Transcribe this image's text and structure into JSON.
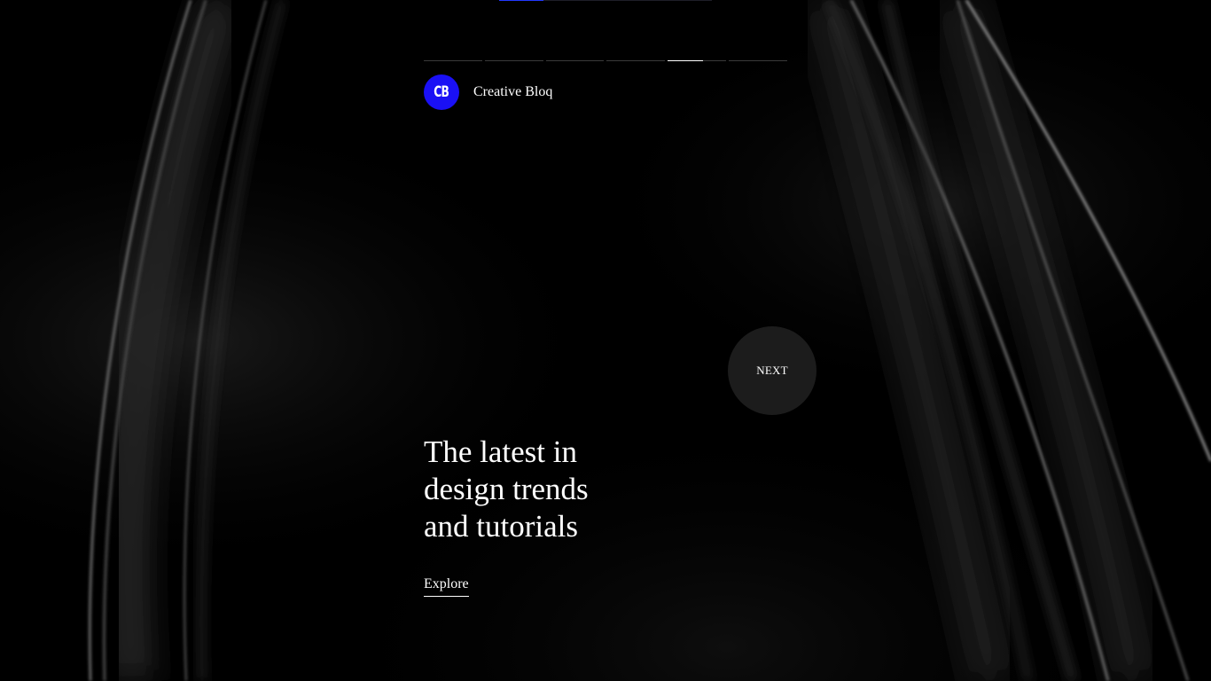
{
  "brand": {
    "logo_text": "CB",
    "logo_color": "#1a10f5",
    "name": "Creative Bloq"
  },
  "stories": {
    "total": 6,
    "active_index": 4,
    "active_progress": 0.6
  },
  "next_button": {
    "label": "NEXT"
  },
  "headline": {
    "lines": [
      "The latest in",
      "design trends",
      "and tutorials"
    ]
  },
  "explore": {
    "label": "Explore"
  },
  "colors": {
    "background": "#000000",
    "accent": "#2238ff",
    "text": "#ffffff"
  }
}
